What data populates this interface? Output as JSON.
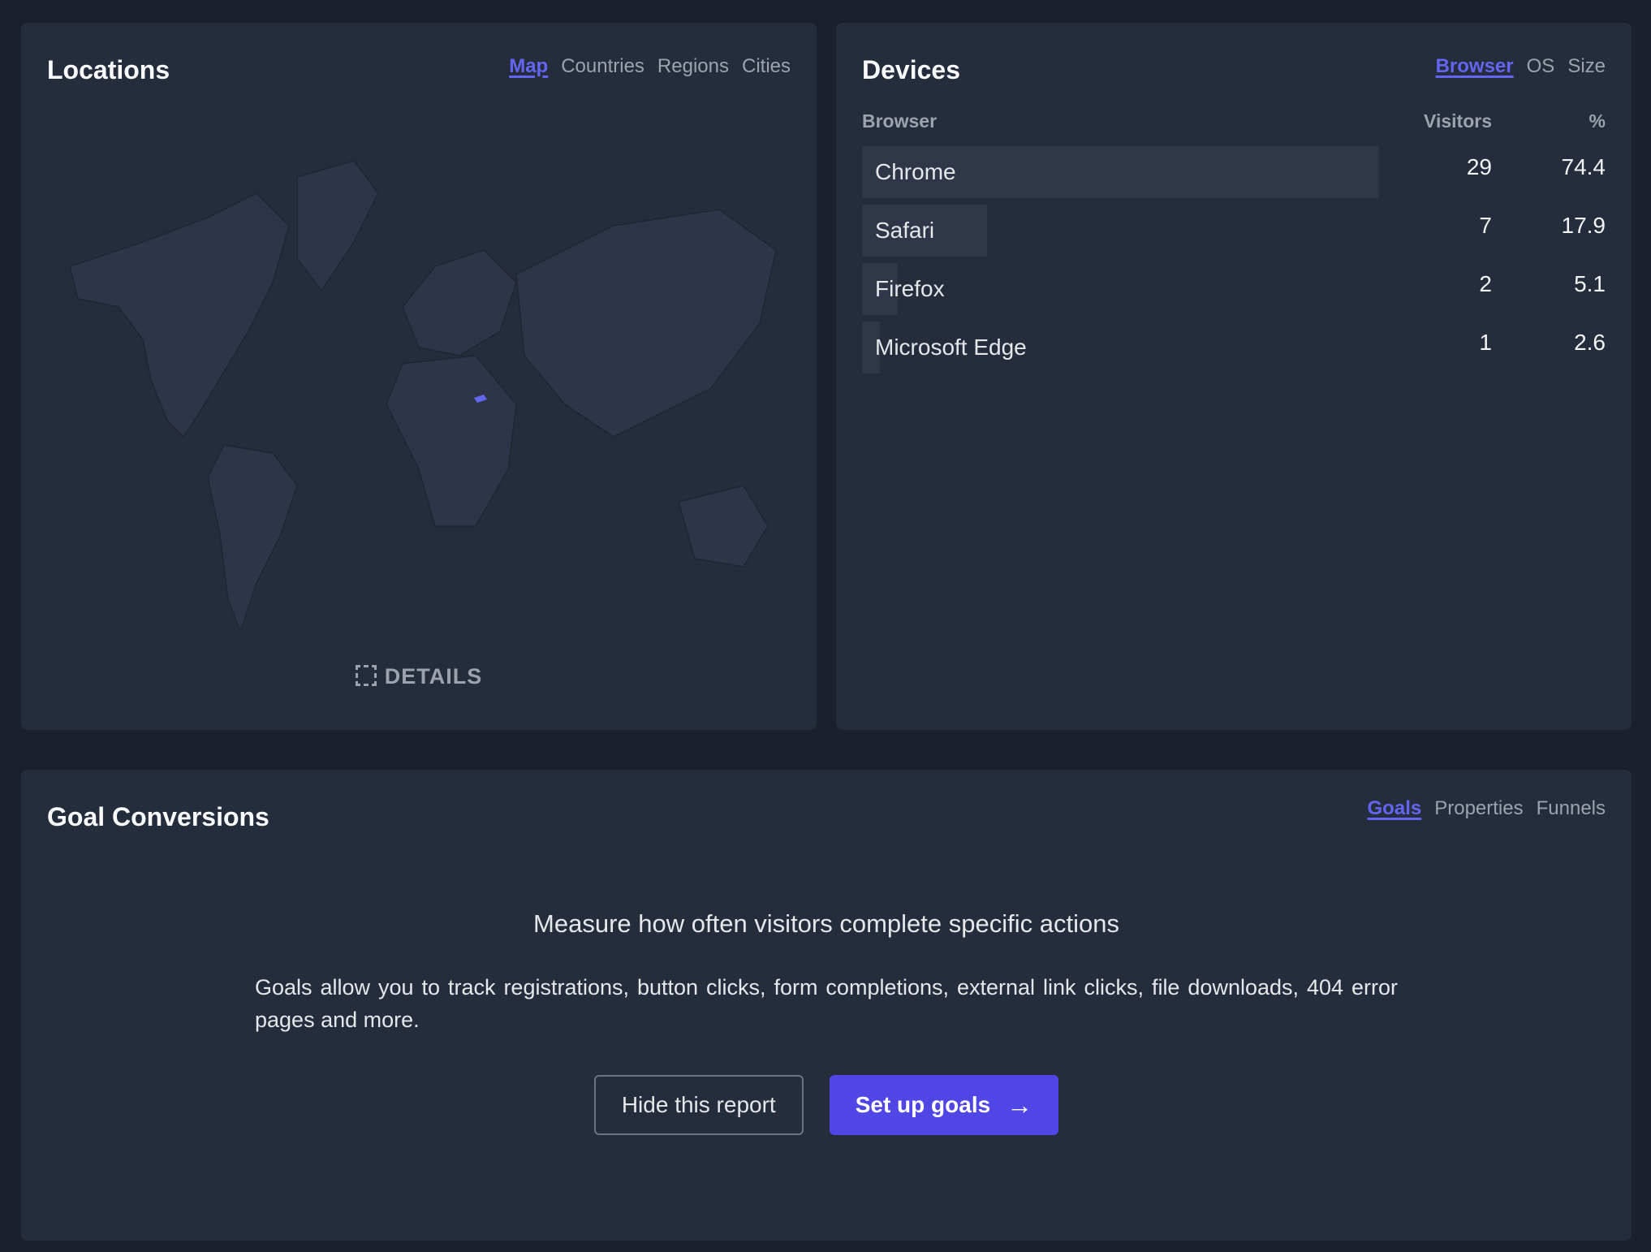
{
  "locations": {
    "title": "Locations",
    "tabs": [
      "Map",
      "Countries",
      "Regions",
      "Cities"
    ],
    "active_tab": "Map",
    "details_label": "DETAILS"
  },
  "devices": {
    "title": "Devices",
    "tabs": [
      "Browser",
      "OS",
      "Size"
    ],
    "active_tab": "Browser",
    "columns": [
      "Browser",
      "Visitors",
      "%"
    ],
    "rows": [
      {
        "name": "Chrome",
        "visitors": "29",
        "percent": "74.4"
      },
      {
        "name": "Safari",
        "visitors": "7",
        "percent": "17.9"
      },
      {
        "name": "Firefox",
        "visitors": "2",
        "percent": "5.1"
      },
      {
        "name": "Microsoft Edge",
        "visitors": "1",
        "percent": "2.6"
      }
    ]
  },
  "goals": {
    "title": "Goal Conversions",
    "tabs": [
      "Goals",
      "Properties",
      "Funnels"
    ],
    "active_tab": "Goals",
    "heading": "Measure how often visitors complete specific actions",
    "description": "Goals allow you to track registrations, button clicks, form completions, external link clicks, file downloads, 404 error pages and more.",
    "hide_label": "Hide this report",
    "setup_label": "Set up goals"
  },
  "colors": {
    "accent": "#6366f1",
    "button": "#4f46e5"
  }
}
